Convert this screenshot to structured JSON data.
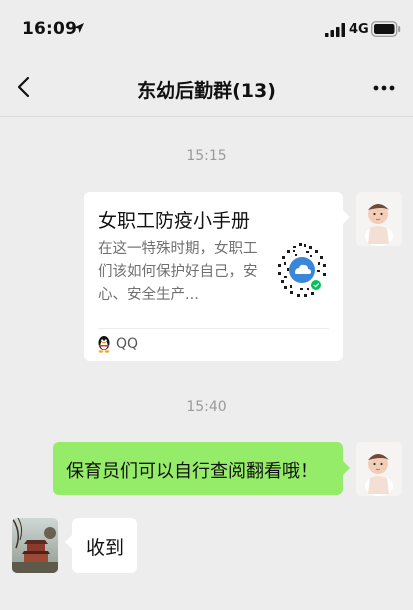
{
  "status": {
    "time": "16:09",
    "network": "4G"
  },
  "header": {
    "title": "东幼后勤群(13)"
  },
  "messages": [
    {
      "timestamp": "15:15"
    },
    {
      "card": {
        "title": "女职工防疫小手册",
        "description": "在这一特殊时期，女职工们该如何保护好自己，安心、安全生产...",
        "source": "QQ"
      }
    },
    {
      "timestamp": "15:40"
    },
    {
      "text": "保育员们可以自行查阅翻看哦！"
    },
    {
      "text": "收到"
    }
  ],
  "icons": {
    "back": "chevron-left-icon",
    "more": "more-dots-icon",
    "source": "qq-penguin-icon"
  },
  "colors": {
    "background": "#ededed",
    "self_bubble": "#95ec69",
    "other_bubble": "#ffffff",
    "timestamp": "#9a9a9a"
  }
}
